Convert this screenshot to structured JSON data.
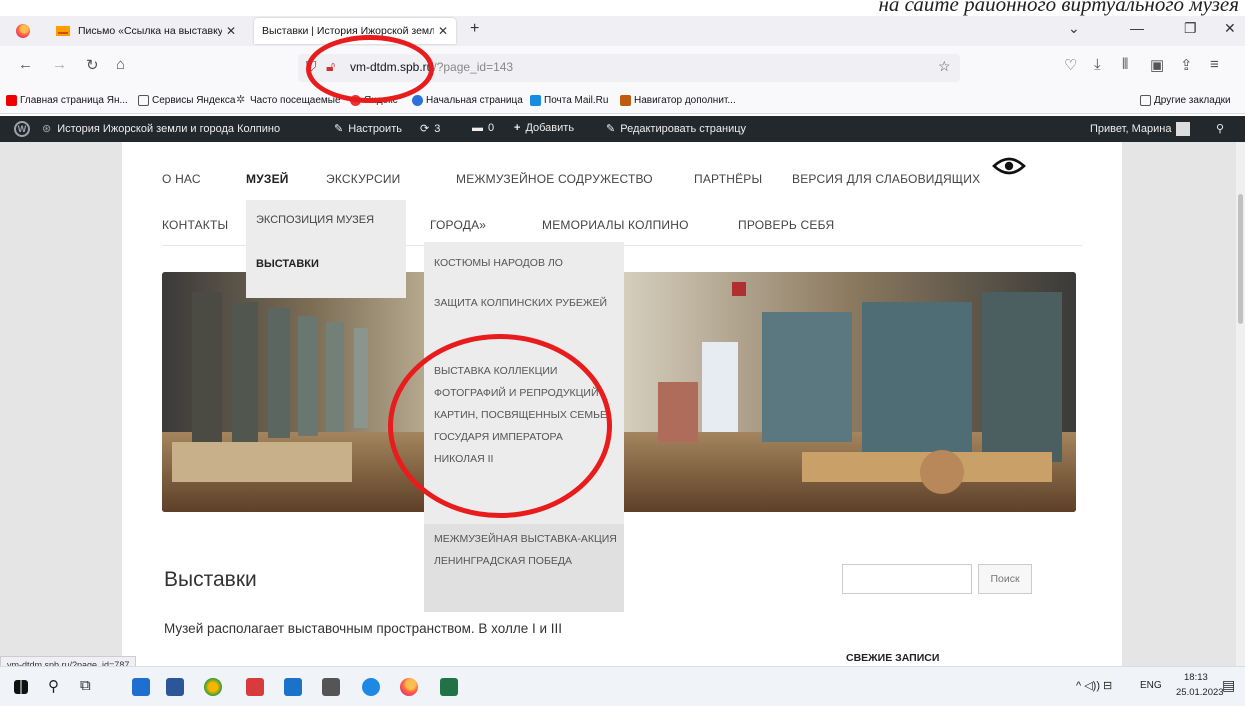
{
  "overlay_caption": "на сайте районного виртуального музея",
  "browser": {
    "tabs": [
      {
        "title": "Письмо «Ссылка на выставку»",
        "active": false
      },
      {
        "title": "Выставки | История Ижорской земли",
        "active": true
      }
    ],
    "new_tab": "+",
    "url_host": "vm-dtdm.spb.ru",
    "url_path": "/?page_id=143",
    "status_url": "vm-dtdm.spb.ru/?page_id=787"
  },
  "bookmarks": {
    "items": [
      "Главная страница Ян...",
      "Сервисы Яндекса",
      "Часто посещаемые",
      "Яндекс",
      "Начальная страница",
      "Почта Mail.Ru",
      "Навигатор дополнит..."
    ],
    "other": "Другие закладки"
  },
  "wp_admin_bar": {
    "site_name": "История Ижорской земли и города Колпино",
    "customize": "Настроить",
    "updates": "3",
    "comments": "0",
    "add_new": "Добавить",
    "edit_page": "Редактировать страницу",
    "greeting": "Привет, Марина"
  },
  "menu": {
    "row1": [
      "О НАС",
      "МУЗЕЙ",
      "ЭКСКУРСИИ",
      "МЕЖМУЗЕЙНОЕ СОДРУЖЕСТВО",
      "ПАРТНЁРЫ",
      "ВЕРСИЯ ДЛЯ СЛАБОВИДЯЩИХ"
    ],
    "row2": [
      "КОНТАКТЫ",
      "ГОРОДА»",
      "МЕМОРИАЛЫ КОЛПИНО",
      "ПРОВЕРЬ СЕБЯ"
    ],
    "dropdown_museum": [
      "ЭКСПОЗИЦИЯ МУЗЕЯ",
      "ВЫСТАВКИ"
    ],
    "dropdown_exhibitions": [
      "КОСТЮМЫ НАРОДОВ ЛО",
      "ЗАЩИТА КОЛПИНСКИХ РУБЕЖЕЙ",
      "ВЫСТАВКА КОЛЛЕКЦИИ ФОТОГРАФИЙ И РЕПРОДУКЦИЙ КАРТИН, ПОСВЯЩЕННЫХ СЕМЬЕ ГОСУДАРЯ ИМПЕРАТОРА НИКОЛАЯ II",
      "МЕЖМУЗЕЙНАЯ ВЫСТАВКА-АКЦИЯ ЛЕНИНГРАДСКАЯ ПОБЕДА"
    ]
  },
  "page": {
    "title": "Выставки",
    "intro": "Музей располагает выставочным пространством. В холле I и III",
    "search_button": "Поиск",
    "recent_posts": "СВЕЖИЕ ЗАПИСИ"
  },
  "taskbar": {
    "lang": "ENG",
    "time": "18:13",
    "date": "25.01.2023"
  },
  "colors": {
    "annotation_red": "#e81c1c",
    "wp_bar": "#23282d"
  }
}
